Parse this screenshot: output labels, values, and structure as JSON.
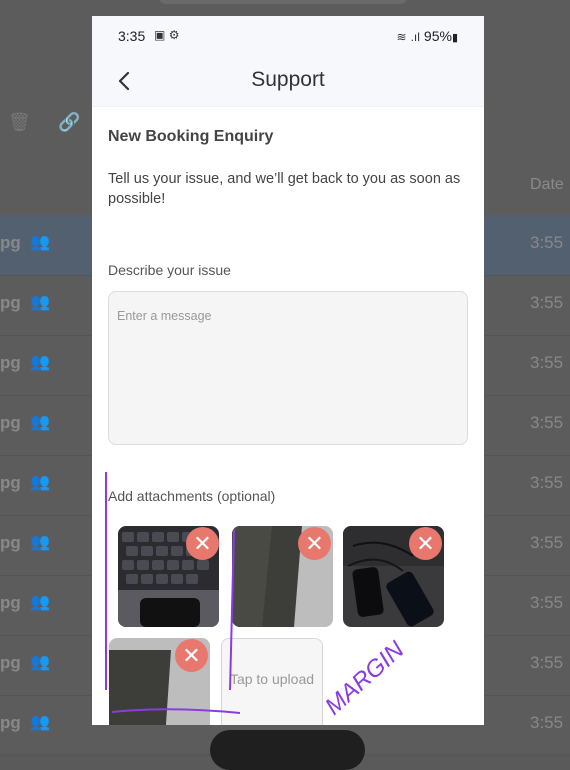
{
  "status_bar": {
    "time": "3:35",
    "battery": "95%",
    "icons": [
      "image-icon",
      "gear-icon",
      "wifi-icon",
      "signal-icon",
      "battery-icon"
    ]
  },
  "app_bar": {
    "title": "Support",
    "back_icon": "chevron-left-icon"
  },
  "form": {
    "heading": "New Booking Enquiry",
    "intro": "Tell us your issue, and we’ll get back to you as soon as possible!",
    "describe_label": "Describe your issue",
    "message_placeholder": "Enter a message",
    "message_value": "",
    "attachments_label": "Add attachments (optional)",
    "upload_tile_label": "Tap to upload",
    "attachments": [
      {
        "subject": "keyboard and phone photo"
      },
      {
        "subject": "dark phone screen photo"
      },
      {
        "subject": "phones on desk photo"
      },
      {
        "subject": "dark phone screen photo"
      }
    ]
  },
  "background": {
    "date_header": "Date",
    "rows": [
      {
        "name": "pg",
        "time": "3:55"
      },
      {
        "name": "pg",
        "time": "3:55"
      },
      {
        "name": "pg",
        "time": "3:55"
      },
      {
        "name": "pg",
        "time": "3:55"
      },
      {
        "name": "pg",
        "time": "3:55"
      },
      {
        "name": "pg",
        "time": "3:55"
      },
      {
        "name": "pg",
        "time": "3:55"
      },
      {
        "name": "pg",
        "time": "3:55"
      },
      {
        "name": "pg",
        "time": "3:55"
      }
    ]
  },
  "annotation": {
    "handwritten_text": "MARGIN",
    "ink_color": "#8a3ce0"
  }
}
